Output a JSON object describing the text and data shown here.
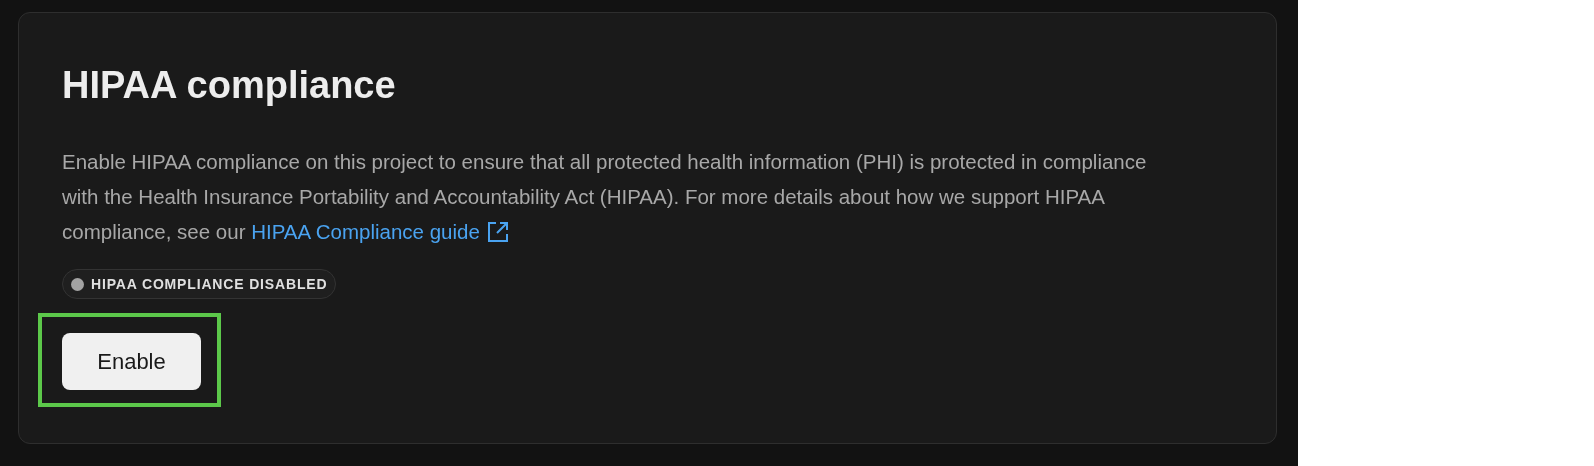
{
  "card": {
    "title": "HIPAA compliance",
    "description": "Enable HIPAA compliance on this project to ensure that all protected health information (PHI) is protected in compliance with the Health Insurance Portability and Accountability Act (HIPAA). For more details about how we support HIPAA compliance, see our",
    "link": "HIPAA Compliance guide",
    "status": {
      "label": "HIPAA COMPLIANCE DISABLED",
      "color": "#a3a3a3"
    },
    "button": {
      "label": "Enable",
      "highlighted": true
    }
  }
}
